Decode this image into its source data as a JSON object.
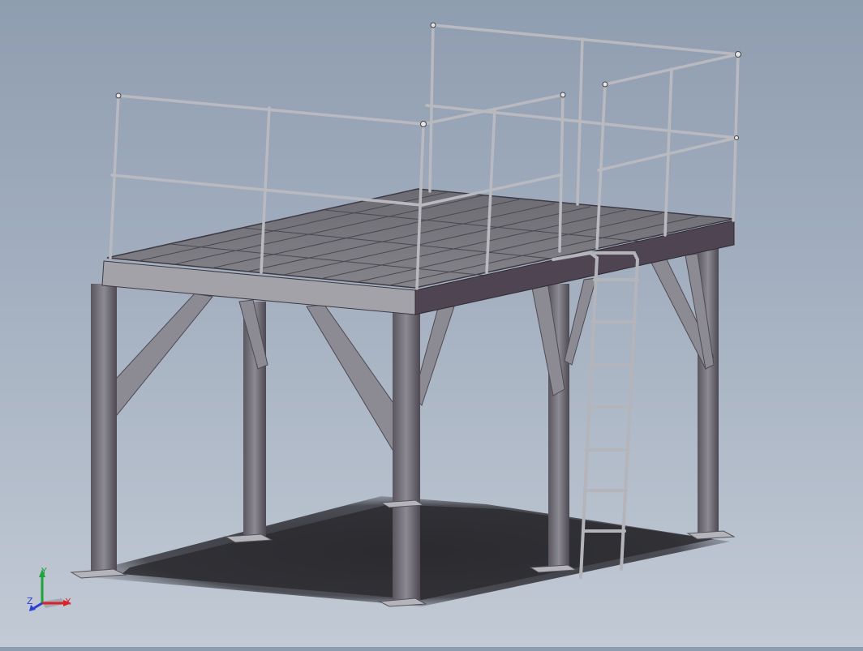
{
  "view": {
    "model": "steel-platform-with-guardrails-and-ladder",
    "background_top": "#8f9db0",
    "background_bottom": "#c2cad5"
  },
  "triad": {
    "x_label": "X",
    "y_label": "Y",
    "z_label": "Z",
    "x_color": "#d8232a",
    "y_color": "#1fa33a",
    "z_color": "#2b3fd6"
  },
  "colors": {
    "steel_light": "#9a9aa0",
    "steel_mid": "#6f6c74",
    "steel_dark": "#4a4450",
    "deck_top": "#77767c",
    "rail": "#c9c9cf",
    "shadow": "#2e2e33"
  }
}
